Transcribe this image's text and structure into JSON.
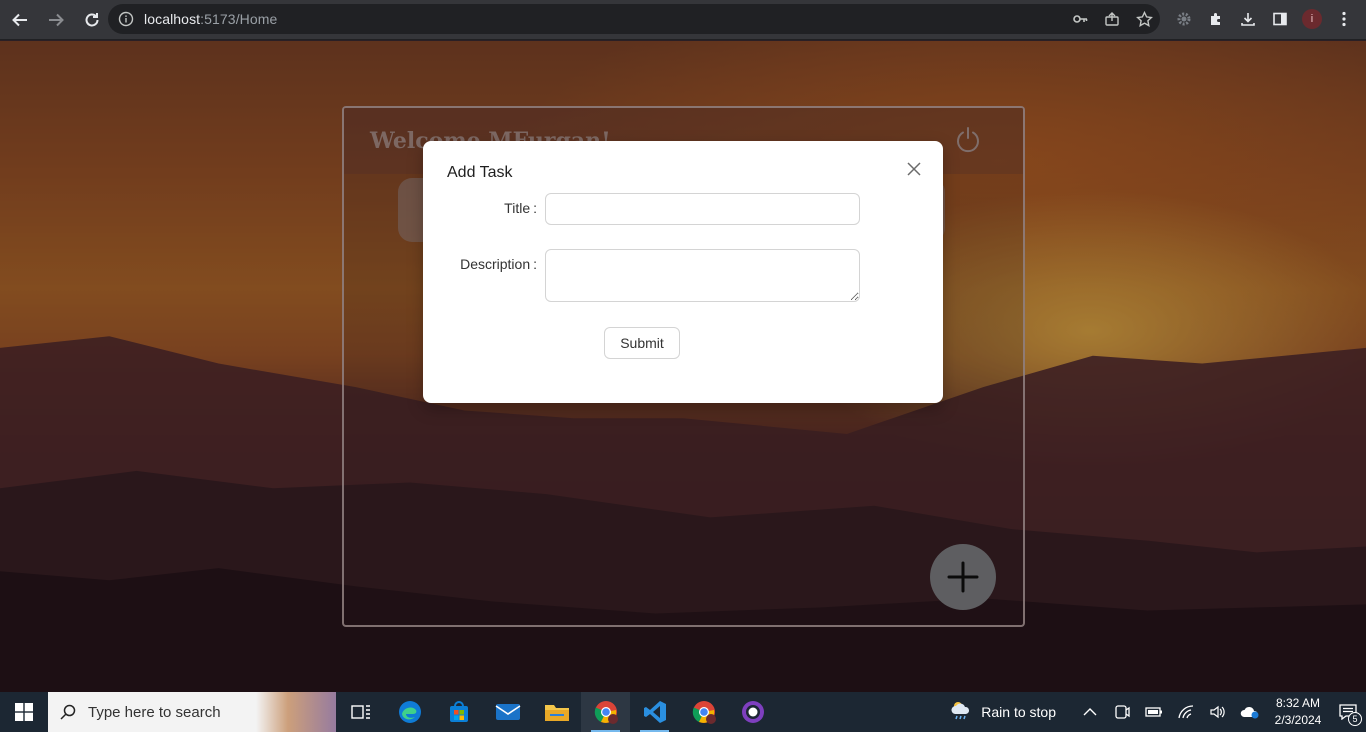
{
  "browser": {
    "url_host": "localhost",
    "url_path": ":5173/Home",
    "avatar_letter": "i"
  },
  "app": {
    "welcome_text": "Welcome MFurqan!"
  },
  "modal": {
    "title": "Add Task",
    "title_label": "Title",
    "description_label": "Description",
    "colon": ":",
    "title_value": "",
    "description_value": "",
    "submit_label": "Submit"
  },
  "taskbar": {
    "search_placeholder": "Type here to search",
    "weather_text": "Rain to stop",
    "time": "8:32 AM",
    "date": "2/3/2024",
    "notification_count": "5"
  }
}
